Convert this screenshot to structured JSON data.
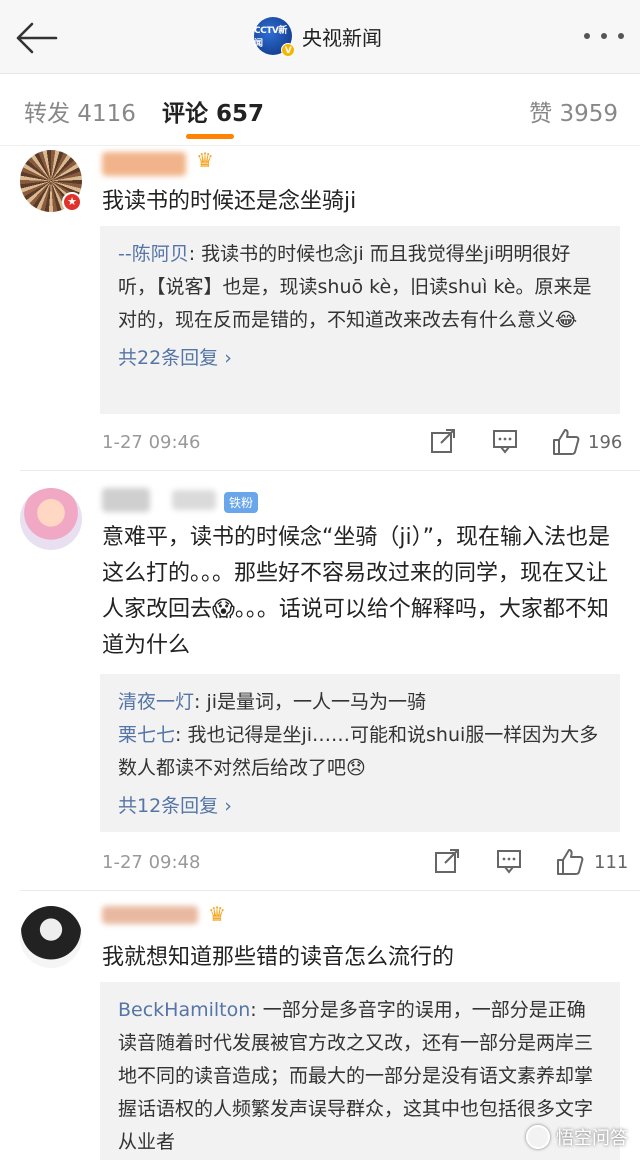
{
  "header": {
    "account_name": "央视新闻",
    "avatar_text": "CCTV新闻",
    "verified_mark": "V"
  },
  "tabs": [
    {
      "label": "转发 4116"
    },
    {
      "label": "评论 657"
    },
    {
      "label": "赞 3959"
    }
  ],
  "colors": {
    "accent": "#ff8200",
    "link": "#5575a6",
    "fan_badge": "#6aa6ea"
  },
  "comments": [
    {
      "text": "我读书的时候还是念坐骑ji",
      "replies": [
        {
          "name": "--陈阿贝",
          "text": ": 我读书的时候也念ji 而且我觉得坐ji明明很好听，【说客】也是，现读shuō kè，旧读shuì kè。原来是对的，现在反而是错的，不知道改来改去有什么意义😂"
        }
      ],
      "more_replies": "共22条回复 ›",
      "time": "1-27 09:46",
      "likes": "196"
    },
    {
      "fan_badge": "铁粉",
      "text": "意难平，读书的时候念“坐骑（ji）”，现在输入法也是这么打的。。。那些好不容易改过来的同学，现在又让人家改回去😱。。。话说可以给个解释吗，大家都不知道为什么",
      "replies": [
        {
          "name": "清夜一灯",
          "text": ": ji是量词，一人一马为一骑"
        },
        {
          "name": "栗七七",
          "text": ": 我也记得是坐ji……可能和说shui服一样因为大多数人都读不对然后给改了吧😞"
        }
      ],
      "more_replies": "共12条回复 ›",
      "time": "1-27 09:48",
      "likes": "111"
    },
    {
      "text": "我就想知道那些错的读音怎么流行的",
      "replies": [
        {
          "name": "BeckHamilton",
          "text": ": 一部分是多音字的误用，一部分是正确读音随着时代发展被官方改之又改，还有一部分是两岸三地不同的读音造成；而最大的一部分是没有语文素养却掌握话语权的人频繁发声误导群众，这其中也包括很多文字从业者"
        }
      ]
    }
  ],
  "watermark": "悟空问答"
}
